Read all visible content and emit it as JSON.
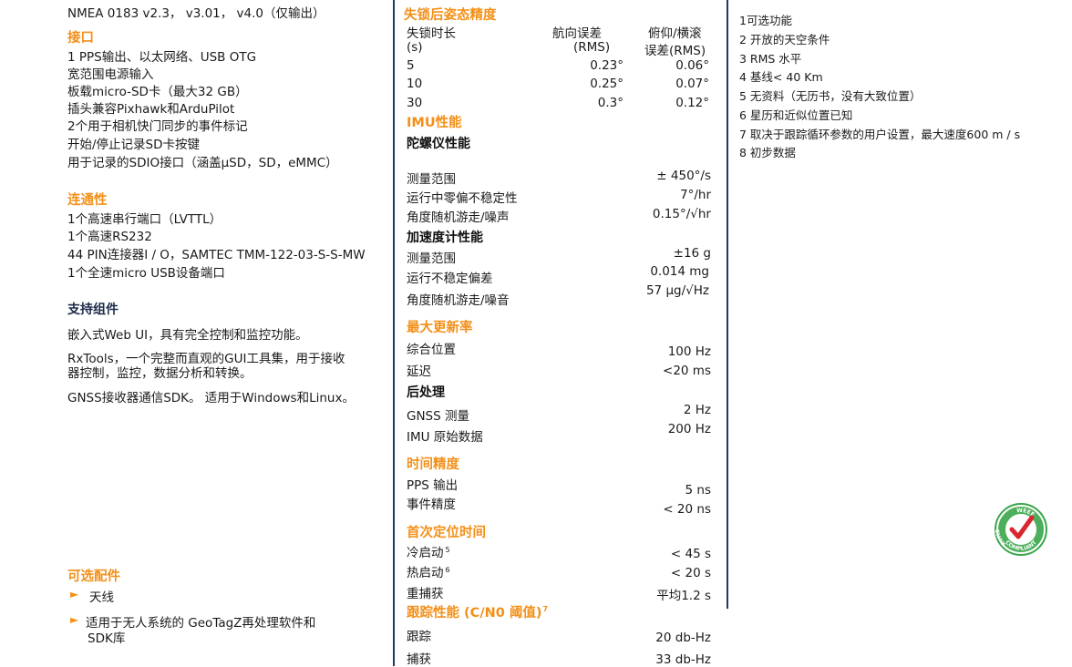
{
  "left": {
    "nmea": "NMEA 0183 v2.3， v3.01， v4.0（仅输出）",
    "interface_title": "接口",
    "interface_items": [
      "1 PPS输出、以太网络、USB OTG",
      "宽范围电源输入",
      "板载micro-SD卡（最大32 GB）",
      "插头兼容Pixhawk和ArduPilot",
      "2个用于相机快门同步的事件标记",
      "开始/停止记录SD卡按键",
      "用于记录的SDIO接口（涵盖μSD，SD，eMMC）"
    ],
    "connectivity_title": "连通性",
    "connectivity_items": [
      "1个高速串行端口（LVTTL）",
      "1个高速RS232",
      "44 PIN连接器I / O，SAMTEC TMM-122-03-S-S-MW",
      "1个全速micro USB设备端口"
    ],
    "support_title": "支持组件",
    "support_items": [
      "嵌入式Web UI，具有完全控制和监控功能。",
      "RxTools，一个完整而直观的GUI工具集，用于接收",
      "器控制，监控，数据分析和转换。",
      "GNSS接收器通信SDK。 适用于Windows和Linux。"
    ],
    "optional_title": "可选配件",
    "optional_items": [
      "天线",
      "适用于无人系统的 GeoTagZ再处理软件和",
      "SDK库"
    ]
  },
  "middle": {
    "attitude_title": "失锁后姿态精度",
    "attitude_headers": {
      "c1a": "失锁时长",
      "c1b": "(s)",
      "c2a": "航向误差",
      "c2b": "(RMS)",
      "c3a": "俯仰/横滚",
      "c3b": "误差(RMS)"
    },
    "attitude_rows": [
      [
        "5",
        "0.23°",
        "0.06°"
      ],
      [
        "10",
        "0.25°",
        "0.07°"
      ],
      [
        "30",
        "0.3°",
        "0.12°"
      ]
    ],
    "imu_title": "IMU性能",
    "gyro_title": "陀螺仪性能",
    "gyro_rows": [
      [
        "测量范围",
        "± 450°/s"
      ],
      [
        "运行中零偏不稳定性",
        "7°/hr"
      ],
      [
        "角度随机游走/噪声",
        "0.15°/√hr"
      ]
    ],
    "accel_title": "加速度计性能",
    "accel_rows": [
      [
        "测量范围",
        "±16 g"
      ],
      [
        "运行不稳定偏差",
        "0.014 mg"
      ],
      [
        "角度随机游走/噪音",
        "57 μg/√Hz"
      ]
    ],
    "update_title": "最大更新率",
    "update_rows": [
      [
        "综合位置",
        "100 Hz"
      ],
      [
        "延迟",
        "<20 ms"
      ]
    ],
    "post_title": "后处理",
    "post_rows": [
      [
        "GNSS 测量",
        "2 Hz"
      ],
      [
        "IMU 原始数据",
        "200 Hz"
      ]
    ],
    "timing_title": "时间精度",
    "timing_rows": [
      [
        "PPS 输出",
        "5 ns"
      ],
      [
        "事件精度",
        "< 20 ns"
      ]
    ],
    "ttff_title": "首次定位时间",
    "ttff_rows": [
      [
        "冷启动",
        "5",
        "< 45 s"
      ],
      [
        "热启动",
        "6",
        "< 20 s"
      ],
      [
        "重捕获",
        "",
        "平均1.2 s"
      ]
    ],
    "tracking_title": "跟踪性能 (C/N0 阈值)",
    "tracking_sup": "7",
    "tracking_rows": [
      [
        "跟踪",
        "20 db-Hz"
      ],
      [
        "捕获",
        "33 db-Hz"
      ]
    ]
  },
  "notes": [
    "1可选功能",
    "2 开放的天空条件",
    "3 RMS 水平",
    "4 基线< 40 Km",
    "5 无资料（无历书，没有大致位置）",
    "6 星历和近似位置已知",
    "7 取决于跟踪循环参数的用户设置，最大速度600 m / s",
    "8 初步数据"
  ],
  "badge": {
    "top": "WEEE",
    "left": "RoHS",
    "bottom": "COMPLIANT",
    "ring_color": "#3aa64a",
    "check_color": "#d9272e"
  }
}
